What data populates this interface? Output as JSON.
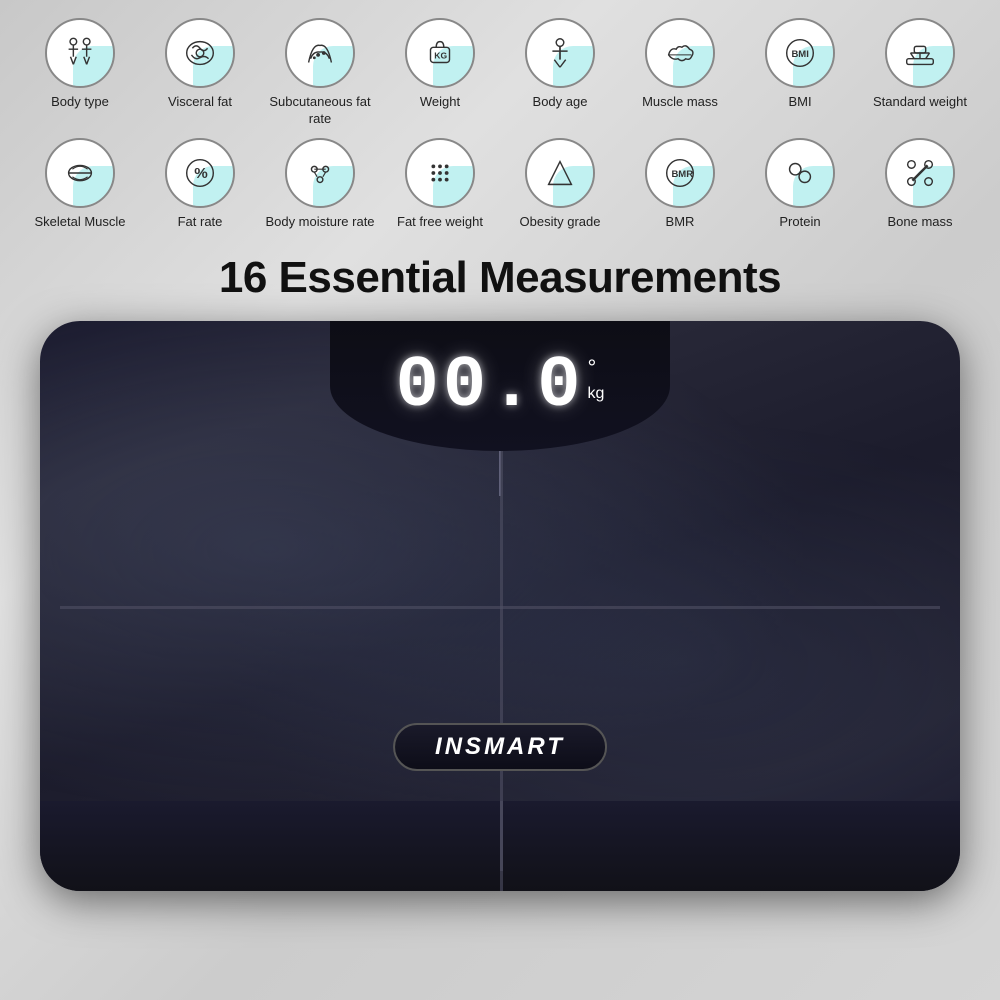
{
  "heading": "16 Essential Measurements",
  "row1": [
    {
      "id": "body-type",
      "label": "Body type",
      "icon": "body"
    },
    {
      "id": "visceral-fat",
      "label": "Visceral fat",
      "icon": "gut"
    },
    {
      "id": "subcutaneous-fat-rate",
      "label": "Subcutaneous fat rate",
      "icon": "fat"
    },
    {
      "id": "weight",
      "label": "Weight",
      "icon": "kg"
    },
    {
      "id": "body-age",
      "label": "Body age",
      "icon": "person"
    },
    {
      "id": "muscle-mass",
      "label": "Muscle mass",
      "icon": "muscle"
    },
    {
      "id": "bmi",
      "label": "BMI",
      "icon": "bmi"
    },
    {
      "id": "standard-weight",
      "label": "Standard weight",
      "icon": "scale"
    }
  ],
  "row2": [
    {
      "id": "skeletal-muscle",
      "label": "Skeletal Muscle",
      "icon": "skeletal"
    },
    {
      "id": "fat-rate",
      "label": "Fat rate",
      "icon": "percent"
    },
    {
      "id": "body-moisture-rate",
      "label": "Body moisture rate",
      "icon": "moisture"
    },
    {
      "id": "fat-free-weight",
      "label": "Fat free weight",
      "icon": "dots"
    },
    {
      "id": "obesity-grade",
      "label": "Obesity grade",
      "icon": "pyramid"
    },
    {
      "id": "bmr",
      "label": "BMR",
      "icon": "bmr"
    },
    {
      "id": "protein",
      "label": "Protein",
      "icon": "protein"
    },
    {
      "id": "bone-mass",
      "label": "Bone mass",
      "icon": "bone"
    }
  ],
  "scale": {
    "display": "00.0",
    "unit": "kg",
    "brand": "INSMART"
  }
}
